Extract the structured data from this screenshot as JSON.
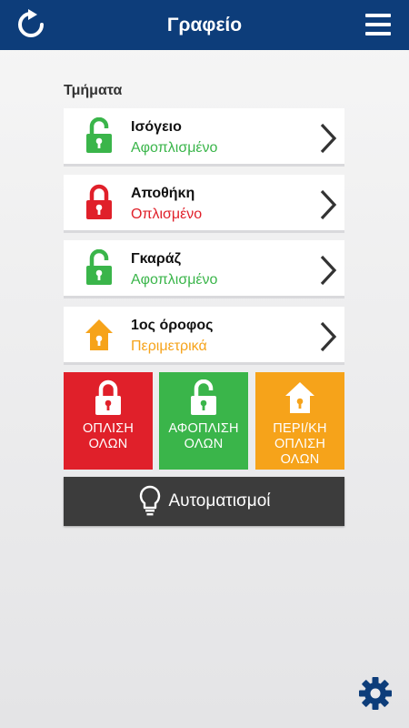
{
  "header": {
    "title": "Γραφείο",
    "refresh_icon": "refresh-icon",
    "menu_icon": "hamburger-menu-icon",
    "background": "#0d3d7a"
  },
  "zones_heading": "Τμήματα",
  "zones": [
    {
      "name": "Ισόγειο",
      "status": "Αφοπλισμένο",
      "state": "disarmed",
      "icon": "unlocked-padlock-icon",
      "color": "#3ab54a"
    },
    {
      "name": "Αποθήκη",
      "status": "Οπλισμένο",
      "state": "armed",
      "icon": "locked-padlock-icon",
      "color": "#e0202a"
    },
    {
      "name": "Γκαράζ",
      "status": "Αφοπλισμένο",
      "state": "disarmed",
      "icon": "unlocked-padlock-icon",
      "color": "#3ab54a"
    },
    {
      "name": "1ος όροφος",
      "status": "Περιμετρικά",
      "state": "perimeter",
      "icon": "house-icon",
      "color": "#f6a31a"
    }
  ],
  "actions": [
    {
      "label": "ΟΠΛΙΣΗ\nΟΛΩΝ",
      "icon": "locked-padlock-icon",
      "color": "#e0202a"
    },
    {
      "label": "ΑΦΟΠΛΙΣΗ\nΟΛΩΝ",
      "icon": "unlocked-padlock-icon",
      "color": "#3ab54a"
    },
    {
      "label": "ΠΕΡΙ/ΚΗ\nΟΠΛΙΣΗ\nΟΛΩΝ",
      "icon": "house-icon",
      "color": "#f6a31a"
    }
  ],
  "automation": {
    "label": "Αυτοματισμοί",
    "icon": "lightbulb-icon"
  },
  "settings_icon": "gear-icon"
}
